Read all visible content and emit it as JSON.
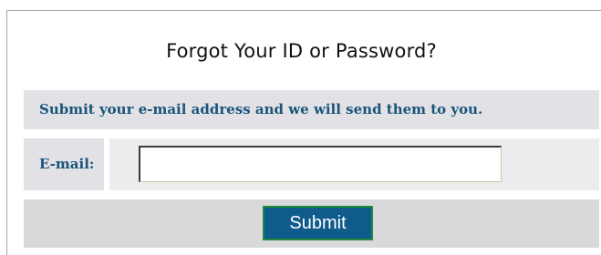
{
  "form": {
    "title": "Forgot Your ID or Password?",
    "instruction": "Submit your e-mail address and we will send them to you.",
    "email_label": "E-mail:",
    "email_value": "",
    "submit_label": "Submit"
  },
  "colors": {
    "label_text": "#19557a",
    "row_background": "#e2e2e6",
    "submit_background": "#0e5b8c",
    "submit_border": "#1f8a3c"
  }
}
